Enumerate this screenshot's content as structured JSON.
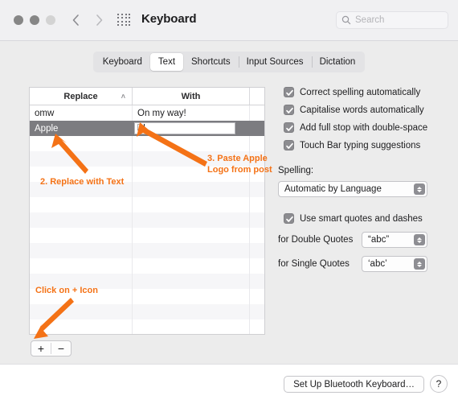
{
  "window": {
    "title": "Keyboard",
    "traffic_lights": [
      "close",
      "minimize",
      "zoom"
    ],
    "back_label": "Back",
    "forward_label": "Forward",
    "grid_label": "Show All",
    "accent_orange": "#f47216",
    "selection_gray": "#7c7c80"
  },
  "search": {
    "placeholder": "Search",
    "value": ""
  },
  "tabs": [
    {
      "label": "Keyboard",
      "active": false
    },
    {
      "label": "Text",
      "active": true
    },
    {
      "label": "Shortcuts",
      "active": false
    },
    {
      "label": "Input Sources",
      "active": false
    },
    {
      "label": "Dictation",
      "active": false
    }
  ],
  "table": {
    "columns": [
      {
        "label": "Replace",
        "sort": "ascending"
      },
      {
        "label": "With"
      }
    ],
    "sort_caret": "˄",
    "rows": [
      {
        "replace": "omw",
        "with": "On my way!",
        "selected": false,
        "editing": false
      },
      {
        "replace": "Apple",
        "with": "",
        "selected": true,
        "editing": true
      }
    ],
    "empty_row_count": 13,
    "add_label": "+",
    "remove_label": "−"
  },
  "options": {
    "checkboxes": [
      {
        "label": "Correct spelling automatically",
        "checked": true
      },
      {
        "label": "Capitalise words automatically",
        "checked": true
      },
      {
        "label": "Add full stop with double-space",
        "checked": true
      },
      {
        "label": "Touch Bar typing suggestions",
        "checked": true
      }
    ],
    "spelling_label": "Spelling:",
    "spelling_value": "Automatic by Language",
    "smart_quotes": {
      "label": "Use smart quotes and dashes",
      "checked": true
    },
    "double_quotes_label": "for Double Quotes",
    "double_quotes_value": "“abc”",
    "single_quotes_label": "for Single Quotes",
    "single_quotes_value": "‘abc’"
  },
  "bottom": {
    "bluetooth_button": "Set Up Bluetooth Keyboard…",
    "help_button": "?"
  },
  "annotations": [
    {
      "id": "step2",
      "text": "2. Replace with Text"
    },
    {
      "id": "step3",
      "text": "3. Paste Apple\nLogo from post"
    },
    {
      "id": "step1",
      "text": "Click on + Icon"
    }
  ]
}
